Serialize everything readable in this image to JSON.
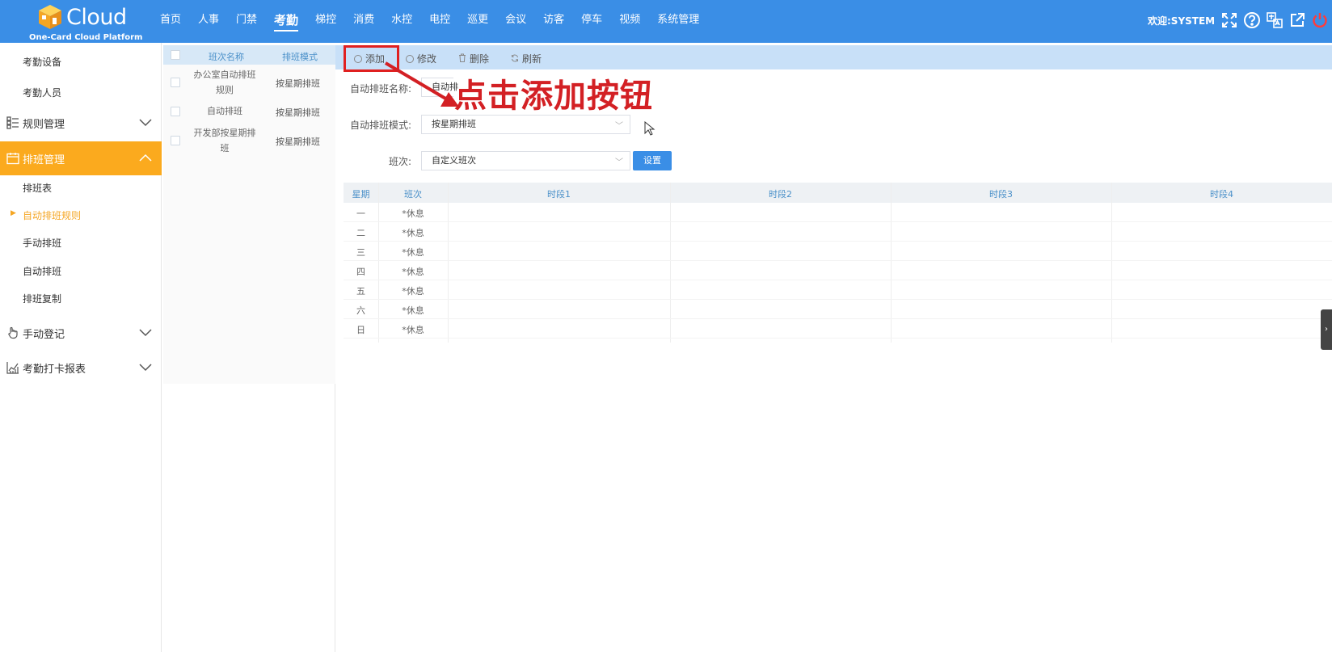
{
  "header": {
    "logo_text": "Cloud",
    "logo_sub": "One-Card Cloud Platform",
    "nav": [
      "首页",
      "人事",
      "门禁",
      "考勤",
      "梯控",
      "消费",
      "水控",
      "电控",
      "巡更",
      "会议",
      "访客",
      "停车",
      "视频",
      "系统管理"
    ],
    "active_nav": "考勤",
    "welcome": "欢迎:SYSTEM",
    "icons": [
      "fullscreen-icon",
      "help-icon",
      "translate-icon",
      "external-link-icon",
      "power-icon"
    ],
    "bg_color": "#3a8ee6"
  },
  "sidebar": {
    "top_items": [
      "考勤设备",
      "考勤人员"
    ],
    "group_rules": "规则管理",
    "group_schedule": "排班管理",
    "schedule_items": [
      "排班表",
      "自动排班规则",
      "手动排班",
      "自动排班",
      "排班复制"
    ],
    "active_item": "自动排班规则",
    "group_manual": "手动登记",
    "group_report": "考勤打卡报表",
    "accent_color": "#fbaa1e"
  },
  "list": {
    "headers": [
      "班次名称",
      "排班模式"
    ],
    "rows": [
      {
        "name_line1": "办公室自动排班",
        "name_line2": "规则",
        "mode": "按星期排班"
      },
      {
        "name_line1": "自动排班",
        "name_line2": "",
        "mode": "按星期排班"
      },
      {
        "name_line1": "开发部按星期排",
        "name_line2": "班",
        "mode": "按星期排班"
      }
    ]
  },
  "toolbar": {
    "add": "添加",
    "edit": "修改",
    "delete": "删除",
    "refresh": "刷新"
  },
  "form": {
    "name_label": "自动排班名称:",
    "name_value": "自动排",
    "mode_label": "自动排班模式:",
    "mode_value": "按星期排班",
    "shift_label": "班次:",
    "shift_value": "自定义班次",
    "set_button": "设置"
  },
  "annotation": "点击添加按钮",
  "table": {
    "headers": [
      "星期",
      "班次",
      "时段1",
      "时段2",
      "时段3",
      "时段4"
    ],
    "rows": [
      {
        "day": "一",
        "shift": "*休息"
      },
      {
        "day": "二",
        "shift": "*休息"
      },
      {
        "day": "三",
        "shift": "*休息"
      },
      {
        "day": "四",
        "shift": "*休息"
      },
      {
        "day": "五",
        "shift": "*休息"
      },
      {
        "day": "六",
        "shift": "*休息"
      },
      {
        "day": "日",
        "shift": "*休息"
      }
    ]
  }
}
